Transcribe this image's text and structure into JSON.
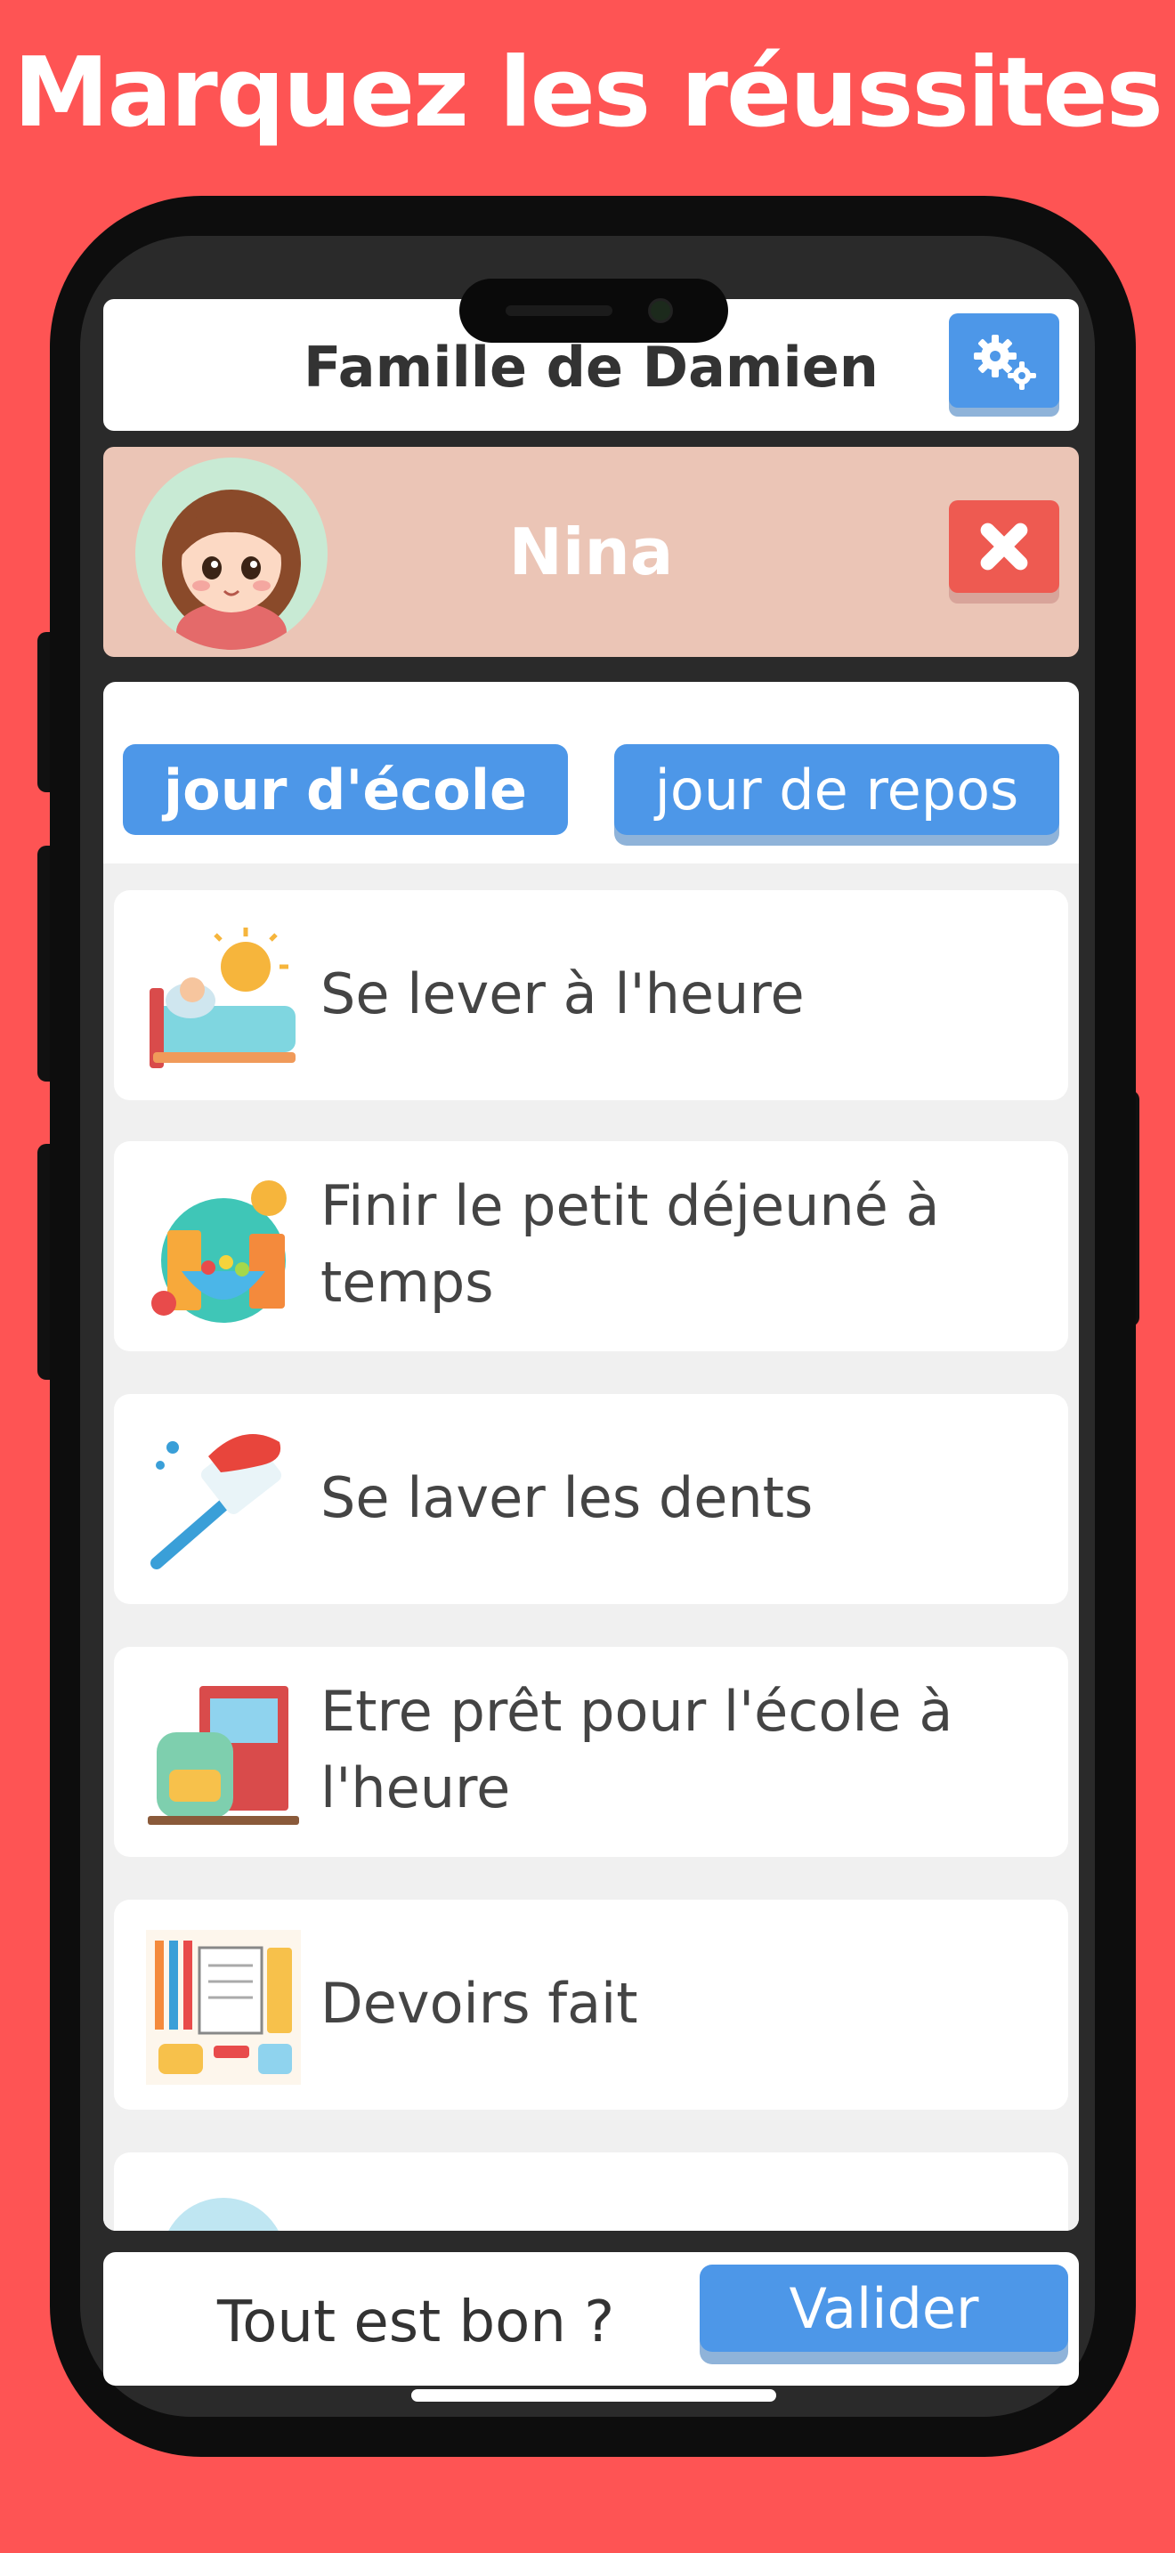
{
  "headline": "Marquez les réussites",
  "header": {
    "title": "Famille de Damien",
    "settings_icon": "gears-icon"
  },
  "profile": {
    "name": "Nina",
    "close_icon": "close-x-icon",
    "bg_color": "#ebc5b6"
  },
  "tabs": [
    {
      "label": "jour d'école",
      "selected": true
    },
    {
      "label": "jour de repos",
      "selected": false
    }
  ],
  "tasks": [
    {
      "label": "Se lever à l'heure",
      "icon": "wake-up-bed-icon",
      "status_color": "#4d97e8"
    },
    {
      "label": "Finir le petit déjeuné à temps",
      "icon": "breakfast-icon",
      "status_color": "#4ccb5f"
    },
    {
      "label": "Se laver les dents",
      "icon": "toothbrush-icon",
      "status_color": "#4d97e8"
    },
    {
      "label": "Etre prêt pour l'école à l'heure",
      "icon": "school-bag-icon",
      "status_color": "#4d97e8"
    },
    {
      "label": "Devoirs fait",
      "icon": "homework-icon",
      "status_color": "#4d97e8"
    }
  ],
  "footer": {
    "question": "Tout est bon ?",
    "validate_label": "Valider"
  },
  "colors": {
    "background": "#fe5454",
    "accent": "#4d97e8",
    "done": "#4ccb5f",
    "danger": "#ee5a51"
  }
}
